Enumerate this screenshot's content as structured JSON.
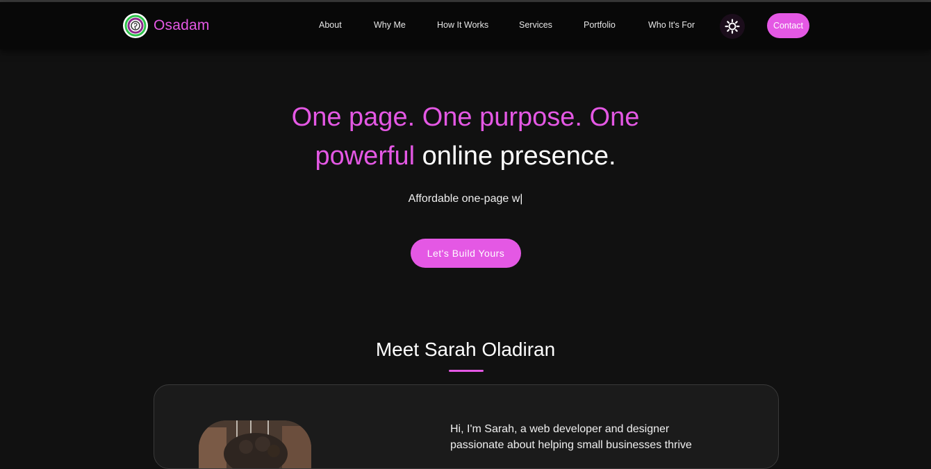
{
  "brand": {
    "name": "Osadam",
    "accent_color": "#e458e4",
    "logo_icon": "brand-logo-icon"
  },
  "nav": {
    "items": [
      {
        "label": "About"
      },
      {
        "label": "Why Me"
      },
      {
        "label": "How It Works"
      },
      {
        "label": "Services"
      },
      {
        "label": "Portfolio"
      },
      {
        "label": "Who It's For"
      }
    ],
    "theme_toggle_icon": "sun-icon",
    "contact_label": "Contact"
  },
  "hero": {
    "title_pink": "One page. One purpose. One powerful",
    "title_white": "online presence.",
    "typing_text": "Affordable one-page w",
    "typing_cursor": "|",
    "cta_label": "Let's Build Yours"
  },
  "about": {
    "heading": "Meet Sarah Oladiran",
    "intro": "Hi, I'm Sarah, a web developer and designer passionate about helping small businesses thrive"
  }
}
